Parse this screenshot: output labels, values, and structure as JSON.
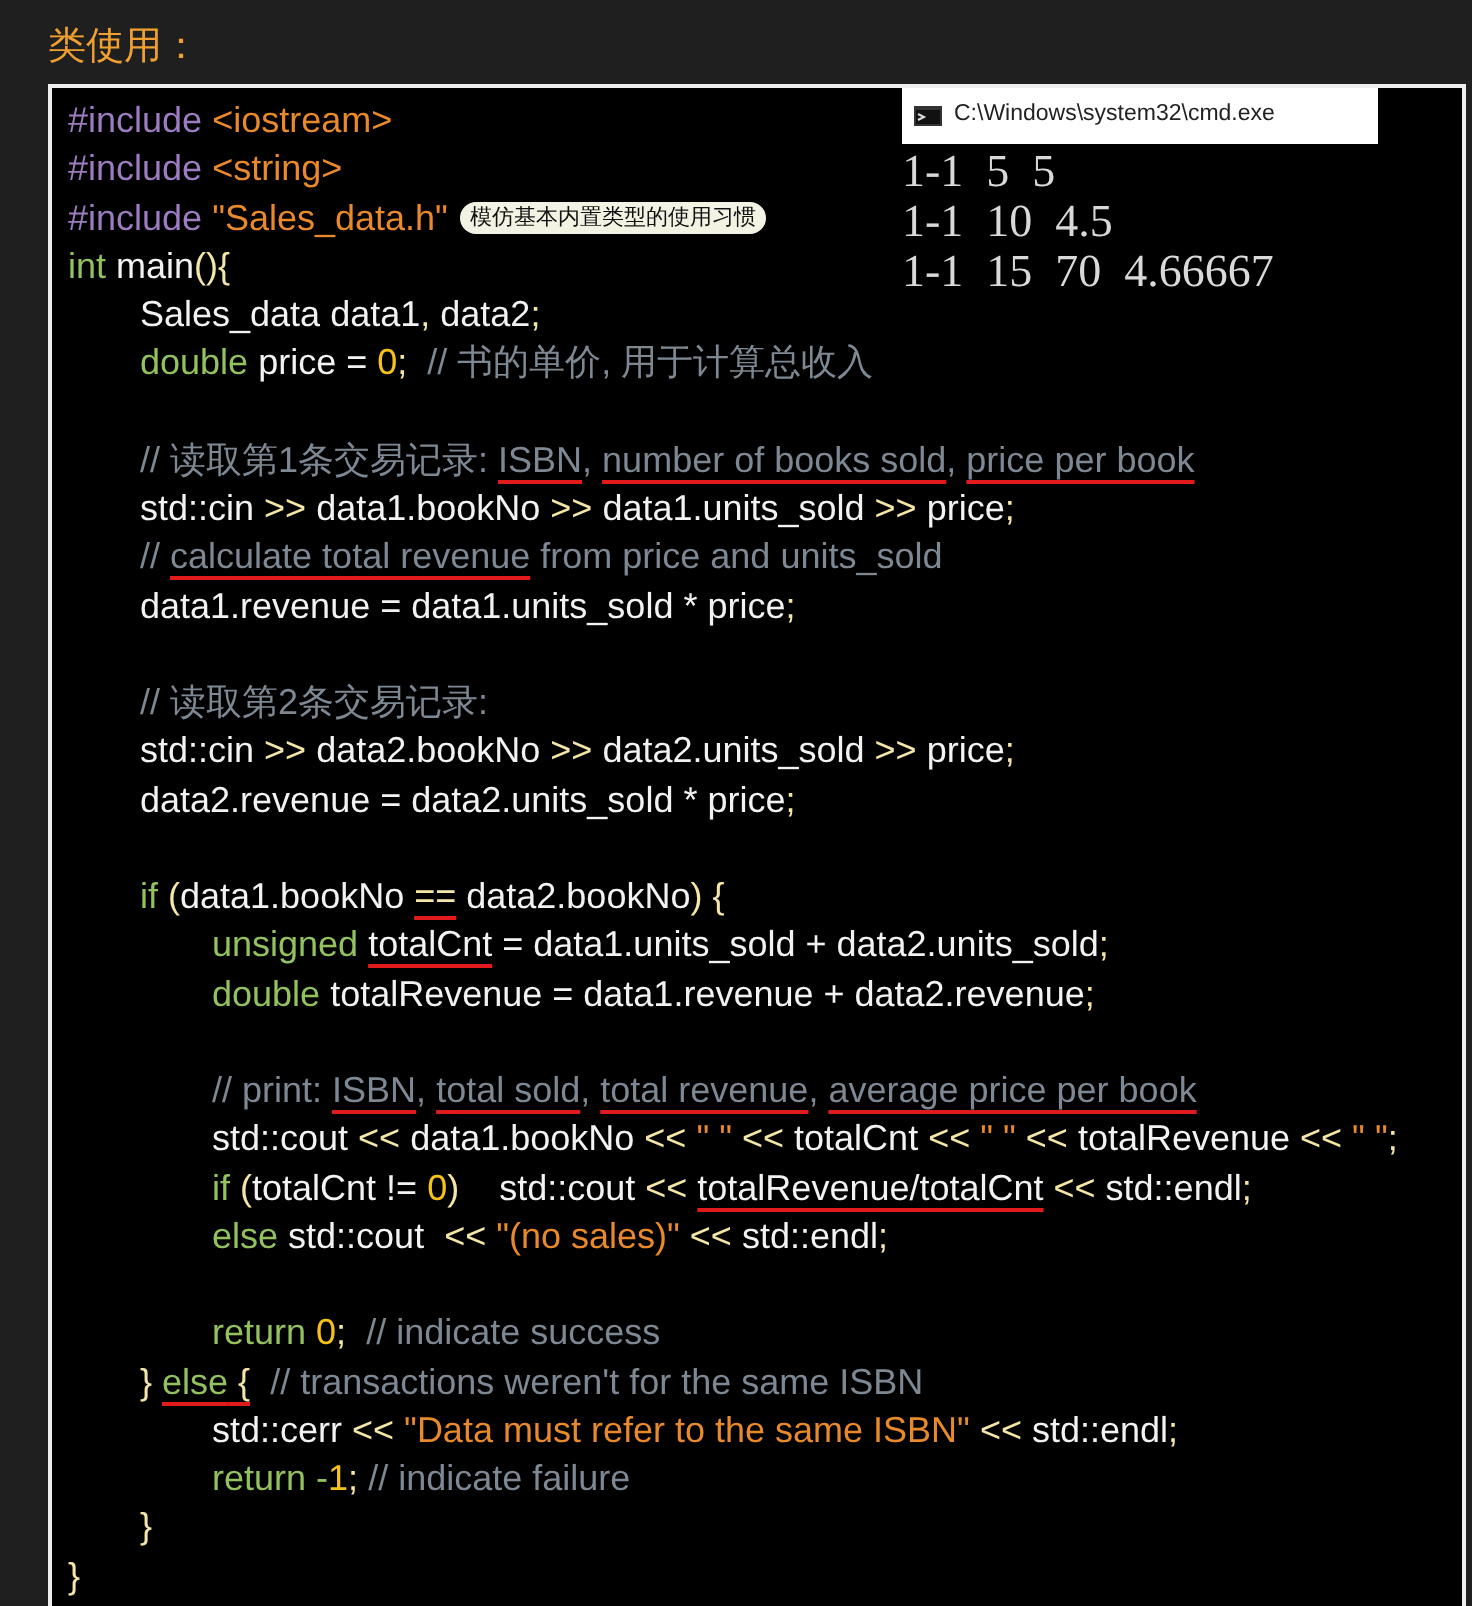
{
  "heading": "类使用：",
  "cmd_window": {
    "title": "C:\\Windows\\system32\\cmd.exe",
    "output": [
      "1-1  5  5",
      "1-1  10  4.5",
      "1-1  15  70  4.66667"
    ]
  },
  "lines": [
    {
      "kind": "code",
      "tokens": [
        {
          "kind": "preproc",
          "text": "#include "
        },
        {
          "kind": "string",
          "text": "<iostream>"
        }
      ]
    },
    {
      "kind": "code",
      "tokens": [
        {
          "kind": "preproc",
          "text": "#include "
        },
        {
          "kind": "string",
          "text": "<string>"
        }
      ]
    },
    {
      "kind": "code",
      "tokens": [
        {
          "kind": "preproc",
          "text": "#include "
        },
        {
          "kind": "string",
          "text": "\"Sales_data.h\""
        }
      ],
      "note": "模仿基本内置类型的使用习惯"
    },
    {
      "kind": "code",
      "tokens": [
        {
          "kind": "keyword",
          "text": "int"
        },
        {
          "kind": "plain",
          "text": " main"
        },
        {
          "kind": "op",
          "text": "(){"
        }
      ],
      "children": [
        {
          "kind": "code",
          "tokens": [
            {
              "kind": "plain",
              "text": "Sales_data data1"
            },
            {
              "kind": "op",
              "text": ","
            },
            {
              "kind": "plain",
              "text": " data2"
            },
            {
              "kind": "op",
              "text": ";"
            }
          ]
        },
        {
          "kind": "code",
          "tokens": [
            {
              "kind": "keyword",
              "text": "double"
            },
            {
              "kind": "plain",
              "text": " price = "
            },
            {
              "kind": "number",
              "text": "0"
            },
            {
              "kind": "op",
              "text": ";"
            },
            {
              "kind": "comment",
              "text": "  // 书的单价, 用于计算总收入"
            }
          ]
        },
        {
          "kind": "blank"
        },
        {
          "kind": "code",
          "tokens": [
            {
              "kind": "comment",
              "text": "// 读取第1条交易记录: "
            },
            {
              "kind": "comment",
              "text": "ISBN",
              "underlined": true,
              "suffix": ", "
            },
            {
              "kind": "comment",
              "text": "number of books sold",
              "underlined": true,
              "suffix": ", "
            },
            {
              "kind": "comment",
              "text": "price per book",
              "underlined": true
            }
          ]
        },
        {
          "kind": "code",
          "tokens": [
            {
              "kind": "plain",
              "text": "std::cin "
            },
            {
              "kind": "op",
              "text": ">>"
            },
            {
              "kind": "plain",
              "text": " data1.bookNo "
            },
            {
              "kind": "op",
              "text": ">>"
            },
            {
              "kind": "plain",
              "text": " data1.units_sold "
            },
            {
              "kind": "op",
              "text": ">>"
            },
            {
              "kind": "plain",
              "text": " price"
            },
            {
              "kind": "op",
              "text": ";"
            }
          ]
        },
        {
          "kind": "code",
          "tokens": [
            {
              "kind": "comment",
              "text": "// "
            },
            {
              "kind": "comment",
              "text": "calculate total revenue",
              "underlined": true
            },
            {
              "kind": "comment",
              "text": " from price and units_sold"
            }
          ]
        },
        {
          "kind": "code",
          "tokens": [
            {
              "kind": "plain",
              "text": "data1.revenue = data1.units_sold * price"
            },
            {
              "kind": "op",
              "text": ";"
            }
          ]
        },
        {
          "kind": "blank"
        },
        {
          "kind": "code",
          "tokens": [
            {
              "kind": "comment",
              "text": "// 读取第2条交易记录:"
            }
          ]
        },
        {
          "kind": "code",
          "tokens": [
            {
              "kind": "plain",
              "text": "std::cin "
            },
            {
              "kind": "op",
              "text": ">>"
            },
            {
              "kind": "plain",
              "text": " data2.bookNo "
            },
            {
              "kind": "op",
              "text": ">>"
            },
            {
              "kind": "plain",
              "text": " data2.units_sold "
            },
            {
              "kind": "op",
              "text": ">>"
            },
            {
              "kind": "plain",
              "text": " price"
            },
            {
              "kind": "op",
              "text": ";"
            }
          ]
        },
        {
          "kind": "code",
          "tokens": [
            {
              "kind": "plain",
              "text": "data2.revenue = data2.units_sold * price"
            },
            {
              "kind": "op",
              "text": ";"
            }
          ]
        },
        {
          "kind": "blank"
        },
        {
          "kind": "code",
          "tokens": [
            {
              "kind": "keyword",
              "text": "if"
            },
            {
              "kind": "op",
              "text": " ("
            },
            {
              "kind": "plain",
              "text": "data1.bookNo "
            },
            {
              "kind": "op",
              "text": "==",
              "underlined": true
            },
            {
              "kind": "plain",
              "text": " data2.bookNo"
            },
            {
              "kind": "op",
              "text": ") {"
            }
          ],
          "children": [
            {
              "kind": "code",
              "tokens": [
                {
                  "kind": "keyword",
                  "text": "unsigned "
                },
                {
                  "kind": "plain",
                  "text": "totalCnt",
                  "underlined": true
                },
                {
                  "kind": "plain",
                  "text": " = data1.units_sold + data2.units_sold"
                },
                {
                  "kind": "op",
                  "text": ";"
                }
              ]
            },
            {
              "kind": "code",
              "tokens": [
                {
                  "kind": "keyword",
                  "text": "double"
                },
                {
                  "kind": "plain",
                  "text": " totalRevenue = data1.revenue + data2.revenue"
                },
                {
                  "kind": "op",
                  "text": ";"
                }
              ]
            },
            {
              "kind": "blank"
            },
            {
              "kind": "code",
              "tokens": [
                {
                  "kind": "comment",
                  "text": "// print: "
                },
                {
                  "kind": "comment",
                  "text": "ISBN",
                  "underlined": true,
                  "suffix": ", "
                },
                {
                  "kind": "comment",
                  "text": "total sold",
                  "underlined": true,
                  "suffix": ", "
                },
                {
                  "kind": "comment",
                  "text": "total revenue",
                  "underlined": true,
                  "suffix": ", "
                },
                {
                  "kind": "comment",
                  "text": "average price per book",
                  "underlined": true
                }
              ]
            },
            {
              "kind": "code",
              "tokens": [
                {
                  "kind": "plain",
                  "text": "std::cout "
                },
                {
                  "kind": "op",
                  "text": "<<"
                },
                {
                  "kind": "plain",
                  "text": " data1.bookNo "
                },
                {
                  "kind": "op",
                  "text": "<<"
                },
                {
                  "kind": "string",
                  "text": " \" \" "
                },
                {
                  "kind": "op",
                  "text": "<<"
                },
                {
                  "kind": "plain",
                  "text": " totalCnt "
                },
                {
                  "kind": "op",
                  "text": "<<"
                },
                {
                  "kind": "string",
                  "text": " \" \" "
                },
                {
                  "kind": "op",
                  "text": "<<"
                },
                {
                  "kind": "plain",
                  "text": " totalRevenue "
                },
                {
                  "kind": "op",
                  "text": "<<"
                },
                {
                  "kind": "string",
                  "text": " \" \""
                },
                {
                  "kind": "op",
                  "text": ";"
                }
              ]
            },
            {
              "kind": "code",
              "tokens": [
                {
                  "kind": "keyword",
                  "text": "if"
                },
                {
                  "kind": "op",
                  "text": " ("
                },
                {
                  "kind": "plain",
                  "text": "totalCnt != "
                },
                {
                  "kind": "number",
                  "text": "0"
                },
                {
                  "kind": "op",
                  "text": ")"
                },
                {
                  "kind": "plain",
                  "text": "    std::cout "
                },
                {
                  "kind": "op",
                  "text": "<< "
                },
                {
                  "kind": "plain",
                  "text": "totalRevenue/totalCnt",
                  "underlined": true
                },
                {
                  "kind": "op",
                  "text": " <<"
                },
                {
                  "kind": "plain",
                  "text": " std::endl"
                },
                {
                  "kind": "op",
                  "text": ";"
                }
              ]
            },
            {
              "kind": "code",
              "tokens": [
                {
                  "kind": "keyword",
                  "text": "else"
                },
                {
                  "kind": "plain",
                  "text": " std::cout  "
                },
                {
                  "kind": "op",
                  "text": "<<"
                },
                {
                  "kind": "string",
                  "text": " \"(no sales)\""
                },
                {
                  "kind": "op",
                  "text": " <<"
                },
                {
                  "kind": "plain",
                  "text": " std::endl"
                },
                {
                  "kind": "op",
                  "text": ";"
                }
              ]
            },
            {
              "kind": "blank"
            },
            {
              "kind": "code",
              "tokens": [
                {
                  "kind": "keyword",
                  "text": "return "
                },
                {
                  "kind": "number",
                  "text": "0"
                },
                {
                  "kind": "op",
                  "text": ";"
                },
                {
                  "kind": "comment",
                  "text": "  // indicate success"
                }
              ]
            }
          ]
        },
        {
          "kind": "code",
          "tokens": [
            {
              "kind": "op",
              "text": "} "
            },
            {
              "kind": "keyword",
              "text": "else",
              "underlined": true
            },
            {
              "kind": "op",
              "text": " {",
              "underlined": true
            },
            {
              "kind": "comment",
              "text": "  // transactions weren't for the same ISBN"
            }
          ],
          "children": [
            {
              "kind": "code",
              "tokens": [
                {
                  "kind": "plain",
                  "text": "std::cerr "
                },
                {
                  "kind": "op",
                  "text": "<<"
                },
                {
                  "kind": "string",
                  "text": " \"Data must refer to the same ISBN\""
                },
                {
                  "kind": "op",
                  "text": " <<"
                },
                {
                  "kind": "plain",
                  "text": " std::endl"
                },
                {
                  "kind": "op",
                  "text": ";"
                }
              ]
            },
            {
              "kind": "code",
              "tokens": [
                {
                  "kind": "keyword",
                  "text": "return -"
                },
                {
                  "kind": "number",
                  "text": "1"
                },
                {
                  "kind": "op",
                  "text": ";"
                },
                {
                  "kind": "comment",
                  "text": " // indicate failure"
                }
              ]
            }
          ]
        },
        {
          "kind": "code",
          "tokens": [
            {
              "kind": "op",
              "text": "}"
            }
          ]
        }
      ]
    },
    {
      "kind": "code",
      "tokens": [
        {
          "kind": "op",
          "text": "}"
        }
      ]
    }
  ]
}
